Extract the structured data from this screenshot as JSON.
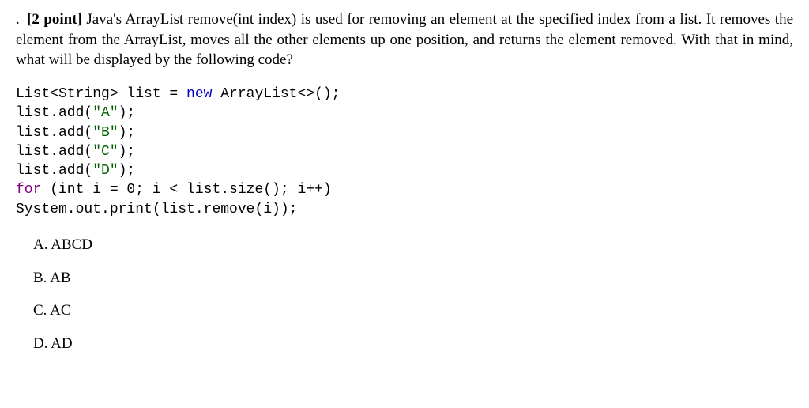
{
  "question": {
    "leading": ".",
    "points_label": "[2 point]",
    "text_part1": " Java's ArrayList remove(int index) is used for removing an element at the specified index from a list. It removes the element from the ArrayList, moves all the other elements up one position, and returns the element removed. With that in mind, what will be displayed by the following code?"
  },
  "code": {
    "l1a": "List<String> list = ",
    "l1b_kw": "new",
    "l1c": " ArrayList<>();",
    "l2a": "list.add(",
    "l2b_str": "\"A\"",
    "l2c": ");",
    "l3a": "list.add(",
    "l3b_str": "\"B\"",
    "l3c": ");",
    "l4a": "list.add(",
    "l4b_str": "\"C\"",
    "l4c": ");",
    "l5a": "list.add(",
    "l5b_str": "\"D\"",
    "l5c": ");",
    "l6a_kw": "for",
    "l6b": " (int i = 0; i < list.size(); i++)",
    "l7": "System.out.print(list.remove(i));"
  },
  "options": {
    "a": "A. ABCD",
    "b": "B. AB",
    "c": "C. AC",
    "d": "D. AD"
  }
}
